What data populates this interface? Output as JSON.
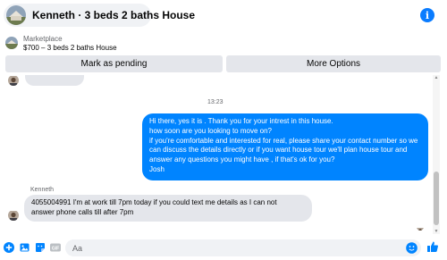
{
  "header": {
    "title": "Kenneth · 3 beds 2 baths House",
    "info_icon": "info-icon",
    "info_glyph": "i"
  },
  "marketplace": {
    "label": "Marketplace",
    "listing": "$700 – 3 beds 2 baths House"
  },
  "actions": {
    "mark_pending": "Mark as pending",
    "more_options": "More Options"
  },
  "conversation": {
    "timestamp": "13:23",
    "outgoing_lines": [
      "Hi there, yes it is . Thank you for your intrest in this house.",
      "how soon are you looking to move on?",
      "if you're comfortable and interested for real, please share your contact number so we",
      "can discuss the details directly or if you  want house tour we'll plan house tour and",
      "answer any questions you might have , if that's ok for you?",
      "Josh"
    ],
    "sender_name": "Kenneth",
    "incoming_lines": [
      "4055004991 I'm at work till 7pm today if you could text me details as I can not",
      "answer phone calls till after 7pm"
    ]
  },
  "composer": {
    "placeholder": "Aa",
    "icons": [
      "plus-circle-icon",
      "photo-icon",
      "sticker-icon",
      "gif-icon",
      "emoji-icon",
      "thumbs-up-icon"
    ],
    "gif_label": "GIF"
  },
  "colors": {
    "accent": "#0084ff",
    "bubble_gray": "#e4e6eb",
    "input_gray": "#f0f2f5",
    "muted_text": "#65676b"
  }
}
